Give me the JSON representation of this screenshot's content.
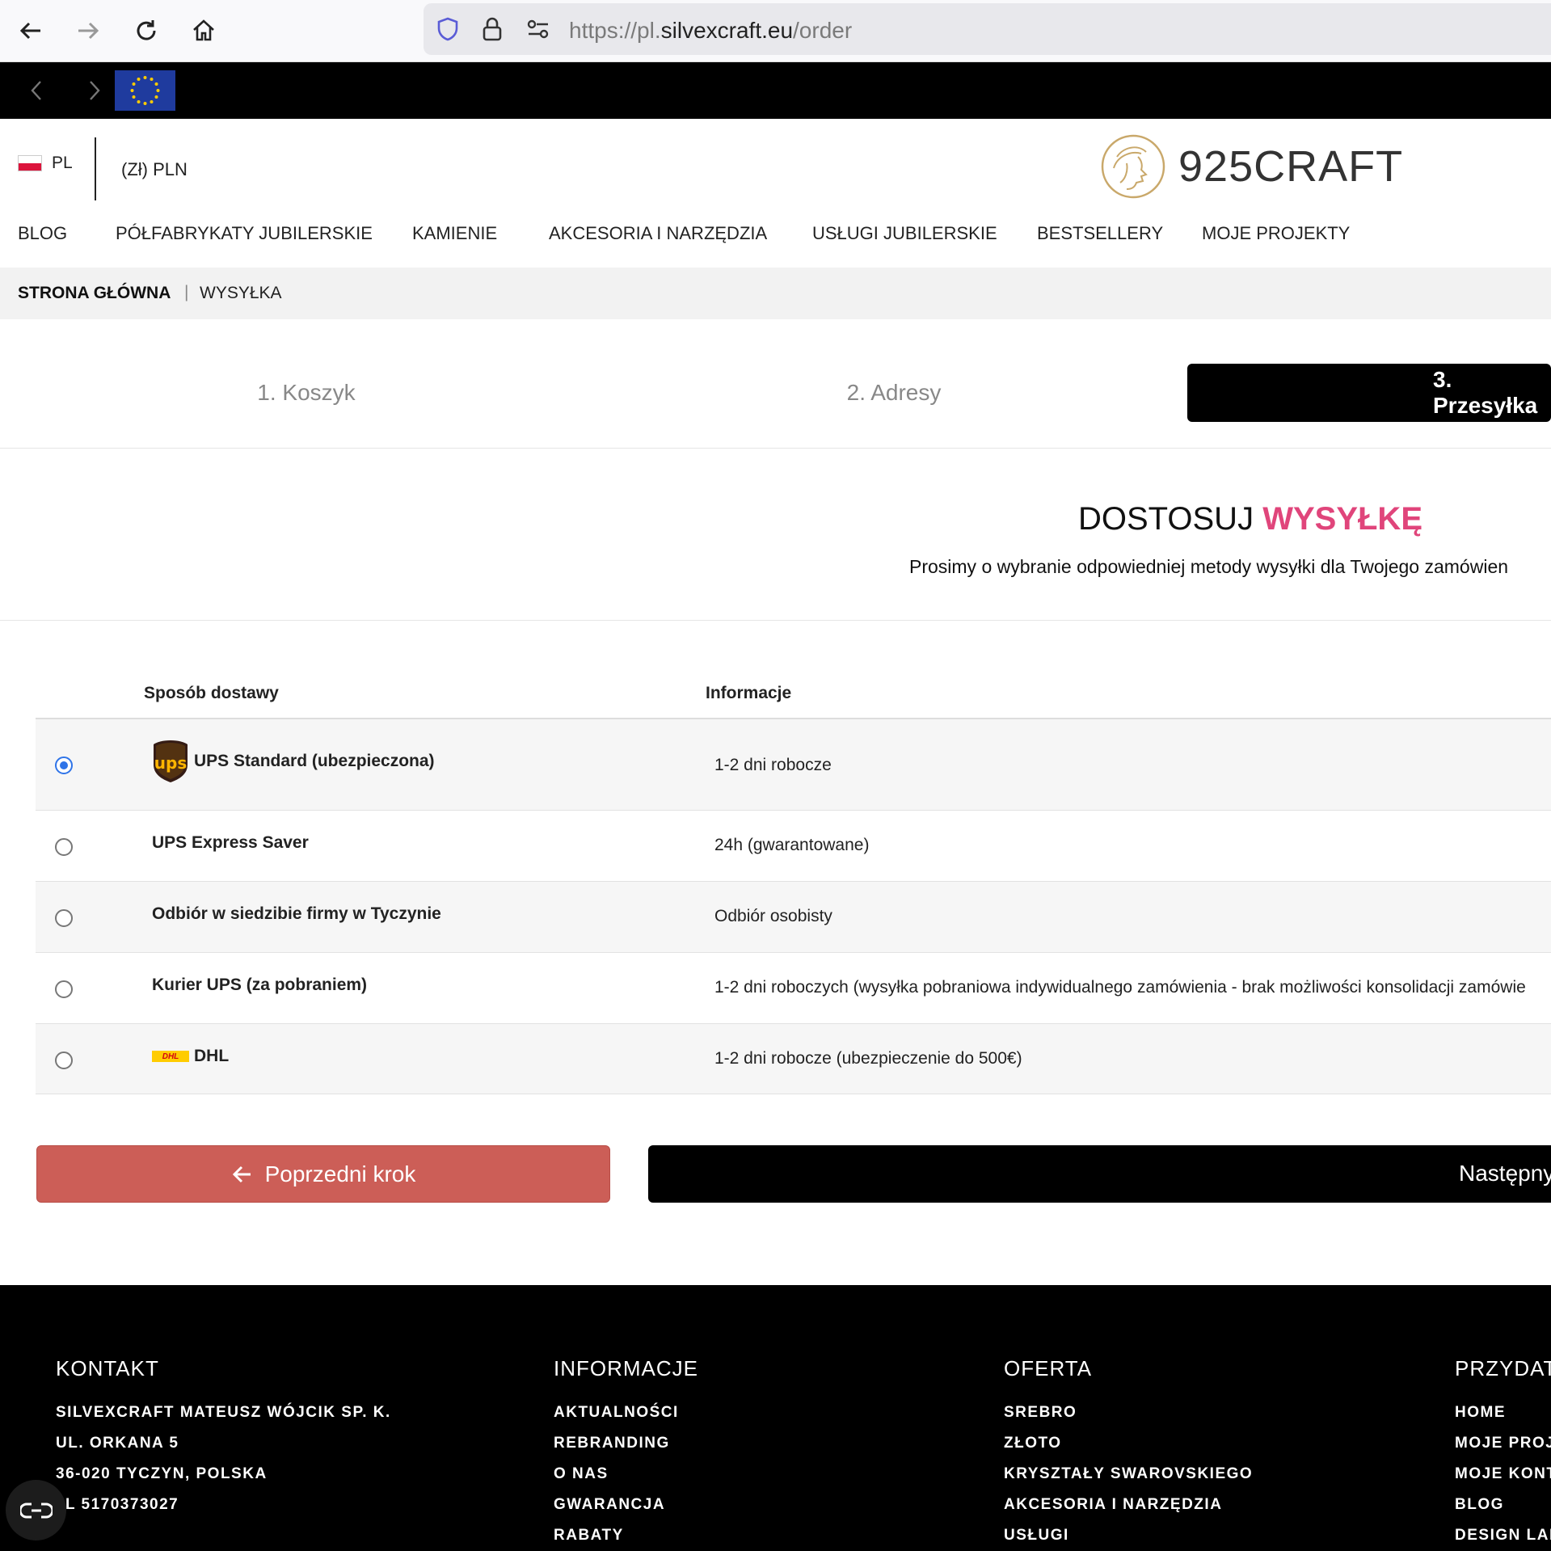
{
  "browser": {
    "url_prefix": "https://pl.",
    "url_domain": "silvexcraft.eu",
    "url_path": "/order"
  },
  "header": {
    "language": "PL",
    "currency": "(Zł) PLN",
    "logo_text": "925CRAFT"
  },
  "nav": {
    "items": [
      "BLOG",
      "PÓŁFABRYKATY JUBILERSKIE",
      "KAMIENIE",
      "AKCESORIA I NARZĘDZIA",
      "USŁUGI JUBILERSKIE",
      "BESTSELLERY",
      "MOJE PROJEKTY"
    ]
  },
  "breadcrumb": {
    "home": "STRONA GŁÓWNA",
    "separator": "|",
    "current": "WYSYŁKA"
  },
  "steps": [
    "1. Koszyk",
    "2. Adresy",
    "3. Przesyłka"
  ],
  "section": {
    "title_main": "DOSTOSUJ",
    "title_accent": "WYSYŁKĘ",
    "subtitle": "Prosimy o wybranie odpowiedniej metody wysyłki dla Twojego zamówien"
  },
  "shipping_table": {
    "col_method": "Sposób dostawy",
    "col_info": "Informacje",
    "rows": [
      {
        "name": "UPS Standard (ubezpieczona)",
        "info": "1-2 dni robocze",
        "selected": true,
        "logo": "ups-logo"
      },
      {
        "name": "UPS Express Saver",
        "info": "24h (gwarantowane)",
        "selected": false
      },
      {
        "name": "Odbiór w siedzibie firmy w Tyczynie",
        "info": "Odbiór osobisty",
        "selected": false
      },
      {
        "name": "Kurier UPS (za pobraniem)",
        "info": "1-2 dni roboczych (wysyłka pobraniowa indywidualnego zamówienia - brak możliwości konsolidacji zamówie",
        "selected": false
      },
      {
        "name": "DHL",
        "info": "1-2 dni robocze (ubezpieczenie do 500€)",
        "selected": false,
        "logo": "dhl-logo",
        "logo_text": "DHL"
      }
    ]
  },
  "buttons": {
    "prev": "Poprzedni krok",
    "next": "Następny"
  },
  "footer": {
    "contact": {
      "title": "KONTAKT",
      "lines": [
        "SILVEXCRAFT MATEUSZ WÓJCIK SP. K.",
        "UL. ORKANA 5",
        "36-020 TYCZYN, POLSKA",
        "L 5170373027"
      ]
    },
    "info": {
      "title": "INFORMACJE",
      "lines": [
        "AKTUALNOŚCI",
        "REBRANDING",
        "O NAS",
        "GWARANCJA",
        "RABATY"
      ]
    },
    "offer": {
      "title": "OFERTA",
      "lines": [
        "SREBRO",
        "ZŁOTO",
        "KRYSZTAŁY SWAROVSKIEGO",
        "AKCESORIA I NARZĘDZIA",
        "USŁUGI"
      ]
    },
    "useful": {
      "title": "PRZYDAT",
      "lines": [
        "HOME",
        "MOJE PROJ",
        "MOJE KONT",
        "BLOG",
        "DESIGN LAB"
      ]
    }
  },
  "colors": {
    "accent_pink": "#e0457b",
    "prev_button": "#cc5e57",
    "radio_selected": "#2f74e8"
  }
}
